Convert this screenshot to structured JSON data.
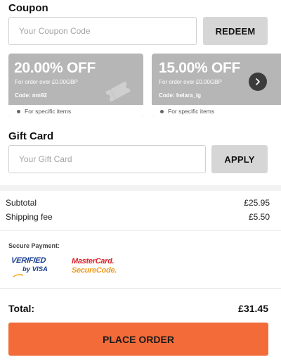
{
  "coupon": {
    "title": "Coupon",
    "input_placeholder": "Your Coupon Code",
    "redeem_label": "REDEEM",
    "cards": [
      {
        "discount": "20.00% OFF",
        "min_order": "For order over £0.00GBP",
        "code": "Code: mn92",
        "note": "For specific items"
      },
      {
        "discount": "15.00% OFF",
        "min_order": "For order over £0.00GBP",
        "code": "Code: helara_lg",
        "note": "For specific items"
      }
    ]
  },
  "gift_card": {
    "title": "Gift Card",
    "input_placeholder": "Your Gift Card",
    "apply_label": "APPLY"
  },
  "summary": {
    "subtotal_label": "Subtotal",
    "subtotal_value": "£25.95",
    "shipping_label": "Shipping fee",
    "shipping_value": "£5.50"
  },
  "payment": {
    "secure_label": "Secure Payment:",
    "visa_line1": "VERIFIED",
    "visa_line2": "by VISA",
    "mc_line1": "MasterCard.",
    "mc_line2": "SecureCode."
  },
  "total": {
    "label": "Total:",
    "value": "£31.45"
  },
  "place_order_label": "PLACE ORDER",
  "colors": {
    "accent": "#f26b38",
    "coupon_card_bg": "#b6b6b6",
    "button_gray": "#d6d6d6",
    "visa_blue": "#1a3d8f",
    "mastercard_red": "#d8232a",
    "mastercard_orange": "#f29b1e"
  }
}
